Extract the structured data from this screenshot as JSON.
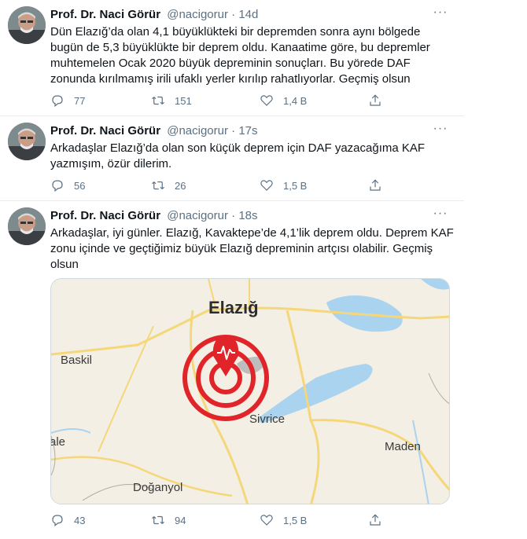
{
  "tweets": [
    {
      "author_name": "Prof. Dr. Naci Görür",
      "handle": "@nacigorur",
      "separator": "·",
      "time": "14d",
      "text": "Dün Elazığ’da olan 4,1 büyüklükteki bir depremden sonra aynı bölgede bugün de 5,3 büyüklükte bir deprem oldu. Kanaatime göre, bu depremler muhtemelen Ocak 2020 büyük depreminin sonuçları. Bu yörede DAF zonunda kırılmamış irili ufaklı yerler kırılıp rahatlıyorlar. Geçmiş olsun",
      "replies": "77",
      "retweets": "151",
      "likes": "1,4 B"
    },
    {
      "author_name": "Prof. Dr. Naci Görür",
      "handle": "@nacigorur",
      "separator": "·",
      "time": "17s",
      "text": "Arkadaşlar Elazığ’da olan son küçük deprem için DAF yazacağıma KAF yazmışım, özür dilerim.",
      "replies": "56",
      "retweets": "26",
      "likes": "1,5 B"
    },
    {
      "author_name": "Prof. Dr. Naci Görür",
      "handle": "@nacigorur",
      "separator": "·",
      "time": "18s",
      "text": "Arkadaşlar, iyi günler. Elazığ, Kavaktepe’de 4,1’lik deprem oldu. Deprem KAF zonu içinde ve geçtiğimiz büyük Elazığ depreminin artçısı olabilir. Geçmiş olsun",
      "replies": "43",
      "retweets": "94",
      "likes": "1,5 B",
      "map": {
        "labels": {
          "elazig": "Elazığ",
          "baskil": "Baskil",
          "sivrice": "Sivrice",
          "maden": "Maden",
          "doganyol": "Doğanyol",
          "ale": "ale"
        },
        "colors": {
          "land": "#f3efe4",
          "water": "#a9d3ee",
          "road": "#f5d77a",
          "epicenter": "#e0242a"
        }
      }
    }
  ],
  "icons": {
    "reply": "reply-icon",
    "retweet": "retweet-icon",
    "like": "like-icon",
    "share": "share-icon",
    "more": "more-icon"
  }
}
